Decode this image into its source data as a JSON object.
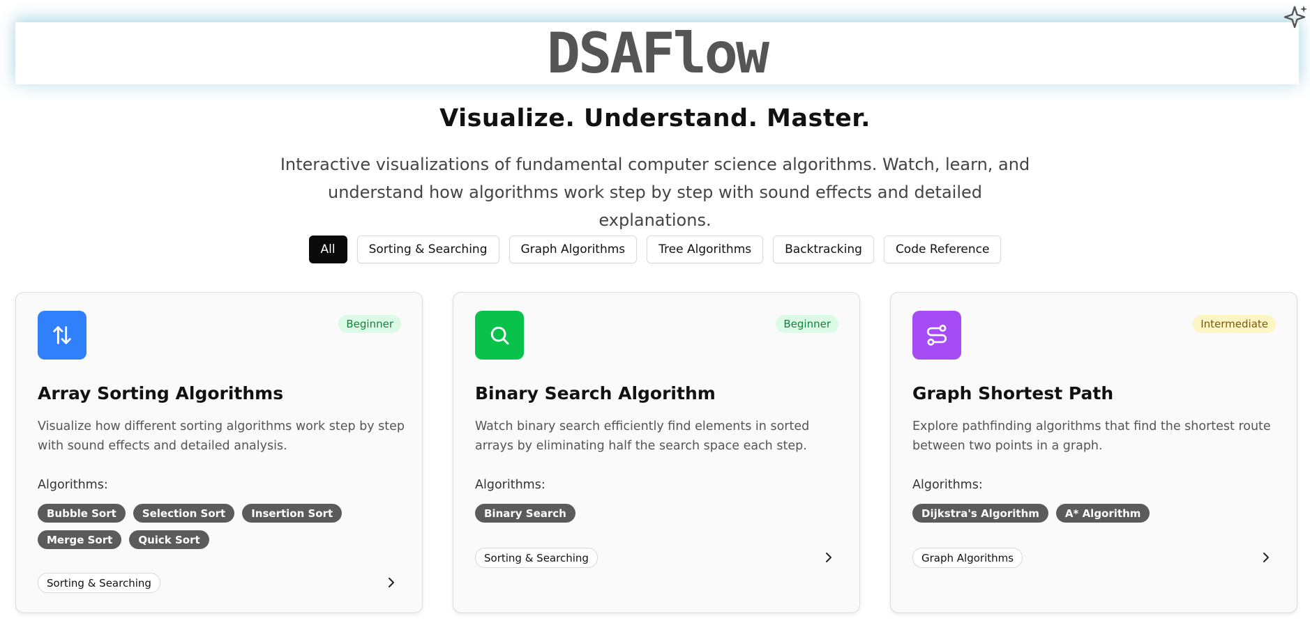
{
  "header": {
    "brand": "DSAFlow"
  },
  "hero": {
    "tagline": "Visualize. Understand. Master.",
    "description": "Interactive visualizations of fundamental computer science algorithms. Watch, learn, and understand how algorithms work step by step with sound effects and detailed explanations."
  },
  "filters": [
    {
      "label": "All",
      "active": true
    },
    {
      "label": "Sorting & Searching",
      "active": false
    },
    {
      "label": "Graph Algorithms",
      "active": false
    },
    {
      "label": "Tree Algorithms",
      "active": false
    },
    {
      "label": "Backtracking",
      "active": false
    },
    {
      "label": "Code Reference",
      "active": false
    }
  ],
  "cards": [
    {
      "icon": "sort-arrows-icon",
      "icon_color": "#2f80fa",
      "level": "Beginner",
      "title": "Array Sorting Algorithms",
      "description": "Visualize how different sorting algorithms work step by step with sound effects and detailed analysis.",
      "algorithms_label": "Algorithms:",
      "algorithms": [
        "Bubble Sort",
        "Selection Sort",
        "Insertion Sort",
        "Merge Sort",
        "Quick Sort"
      ],
      "category": "Sorting & Searching"
    },
    {
      "icon": "search-icon",
      "icon_color": "#08c24b",
      "level": "Beginner",
      "title": "Binary Search Algorithm",
      "description": "Watch binary search efficiently find elements in sorted arrays by eliminating half the search space each step.",
      "algorithms_label": "Algorithms:",
      "algorithms": [
        "Binary Search"
      ],
      "category": "Sorting & Searching"
    },
    {
      "icon": "route-icon",
      "icon_color": "#a64cf5",
      "level": "Intermediate",
      "title": "Graph Shortest Path",
      "description": "Explore pathfinding algorithms that find the shortest route between two points in a graph.",
      "algorithms_label": "Algorithms:",
      "algorithms": [
        "Dijkstra's Algorithm",
        "A* Algorithm"
      ],
      "category": "Graph Algorithms"
    }
  ],
  "colors": {
    "level_beginner_bg": "#dcfbe6",
    "level_beginner_text": "#15803d",
    "level_intermediate_bg": "#fdf5c4",
    "level_intermediate_text": "#7a5a0a"
  }
}
